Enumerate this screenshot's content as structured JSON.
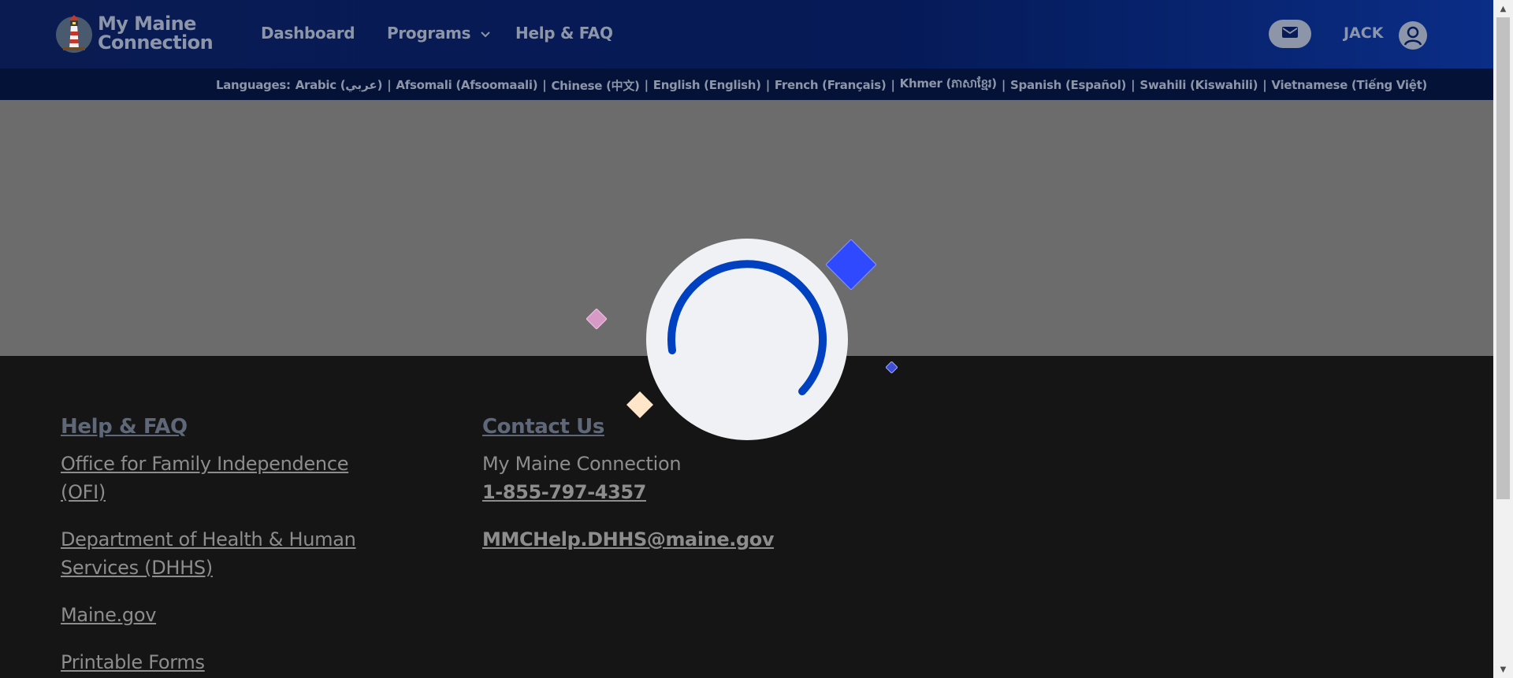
{
  "header": {
    "brand_line1": "My Maine",
    "brand_line2": "Connection",
    "nav": {
      "dashboard": "Dashboard",
      "programs": "Programs",
      "help": "Help & FAQ"
    },
    "user_name": "JACK"
  },
  "languages": {
    "label": "Languages:",
    "items": [
      "Arabic (عربي)",
      "Afsomali (Afsoomaali)",
      "Chinese (中文)",
      "English (English)",
      "French (Français)",
      "Khmer (ភាសាខ្មែរ)",
      "Spanish (Español)",
      "Swahili (Kiswahili)",
      "Vietnamese (Tiếng Việt)"
    ],
    "separator": "|"
  },
  "footer": {
    "help": {
      "heading": "Help & FAQ",
      "links": [
        "Office for Family Independence (OFI)",
        "Department of Health & Human Services (DHHS)",
        "Maine.gov",
        "Printable Forms"
      ]
    },
    "contact": {
      "heading": "Contact Us",
      "org": "My Maine Connection",
      "phone": "1-855-797-4357",
      "email": "MMCHelp.DHHS@maine.gov"
    }
  },
  "colors": {
    "header_bg": "#051a57",
    "language_bar_bg": "#051238",
    "overlay_bg": "#6c6c6c",
    "footer_bg": "#151515",
    "spinner_arc": "#0041c2",
    "text_muted": "#8d96a8"
  }
}
